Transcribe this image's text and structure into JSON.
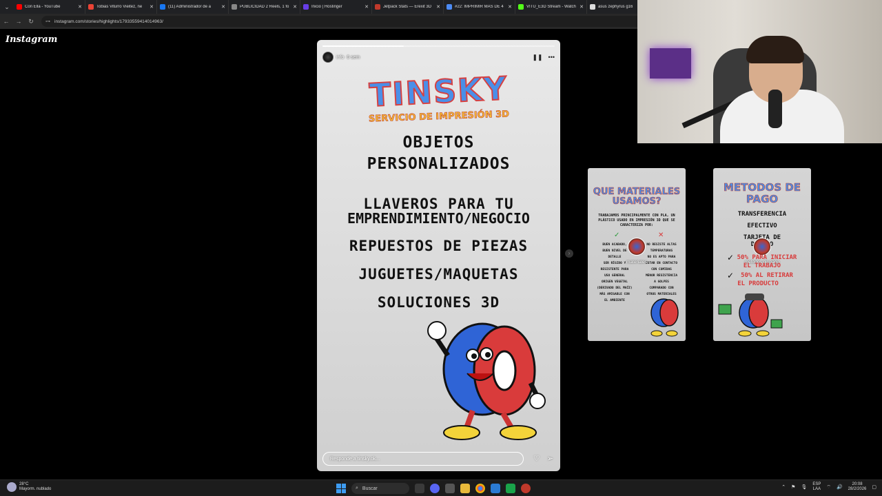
{
  "browser": {
    "tabs": [
      {
        "title": "Con Ella - YouTube",
        "color": "#ff0000"
      },
      {
        "title": "Tobias Viturro Vieitez, ne",
        "color": "#ea4335"
      },
      {
        "title": "(11) Administrador de a",
        "color": "#1877f2"
      },
      {
        "title": "PUBLICIDAD 2 Reels, 1 fo",
        "color": "#888888"
      },
      {
        "title": "Inicio | Hostinger",
        "color": "#673de6"
      },
      {
        "title": "Jetpack Stats — Erexit 3D",
        "color": "#c0392b"
      },
      {
        "title": "#22: IMPRIMIR MAS DE 4",
        "color": "#4c8bf5"
      },
      {
        "title": "VITU_E3D Stream - Watch",
        "color": "#53fc18"
      },
      {
        "title": "asus zephyrus g16",
        "color": "#dddddd"
      }
    ],
    "url": "instagram.com/stories/highlights/17933559414014963/"
  },
  "instagram": {
    "logo": "Instagram",
    "story": {
      "username": "info",
      "time": "6 sem",
      "progress": 0.35,
      "brand": "TINSKY",
      "brand_sub": "SERVICIO DE IMPRESIÓN 3D",
      "lines": [
        "OBJETOS",
        "PERSONALIZADOS",
        "LLAVEROS PARA TU",
        "EMPRENDIMIENTO/NEGOCIO",
        "REPUESTOS DE PIEZAS",
        "JUGUETES/MAQUETAS",
        "SOLUCIONES 3D"
      ],
      "reply_placeholder": "Responde a tinsky.ok...",
      "icons": {
        "pause": "pause-icon",
        "more": "more-icon",
        "like": "heart-icon",
        "share": "send-icon"
      }
    },
    "highlights": [
      {
        "title": "QUE MATERIALES USAMOS?",
        "label": "materiales",
        "intro": "TRABAJAMOS PRINCIPALMENTE CON PLA, UN PLÁSTICO USADO EN IMPRESIÓN 3D QUE SE CARACTERIZA POR:",
        "pros": [
          "BUEN ACABADO,",
          "BUEN NIVEL DE",
          "DETALLE",
          "SER RÍGIDO Y",
          "RESISTENTE PARA",
          "USO GENERAL",
          "ORIGEN VEGETAL",
          "(DERIVADO DEL MAÍZ)",
          "MÁS AMIGABLE CON",
          "EL AMBIENTE"
        ],
        "cons": [
          "NO RESISTE ALTAS",
          "TEMPERATURAS",
          "NO ES APTO PARA",
          "ESTAR EN CONTACTO",
          "CON COMIDAS",
          "MENOR RESISTENCIA",
          "A GOLPES",
          "COMPARADO CON",
          "OTROS MATERIALES"
        ]
      },
      {
        "title": "METODOS DE PAGO",
        "label": "metodos de pago",
        "items": [
          "TRANSFERENCIA",
          "EFECTIVO",
          "TARJETA DE",
          "DÉBITO"
        ],
        "terms": [
          "50% PARA INICIAR",
          "EL TRABAJO",
          "50% AL RETIRAR",
          "EL PRODUCTO"
        ]
      }
    ]
  },
  "taskbar": {
    "temperature": "28°C",
    "weather": "Mayorm. nublado",
    "search_placeholder": "Buscar",
    "lang1": "ESP",
    "lang2": "LAA",
    "time": "20:08",
    "date": "28/2/2026"
  }
}
